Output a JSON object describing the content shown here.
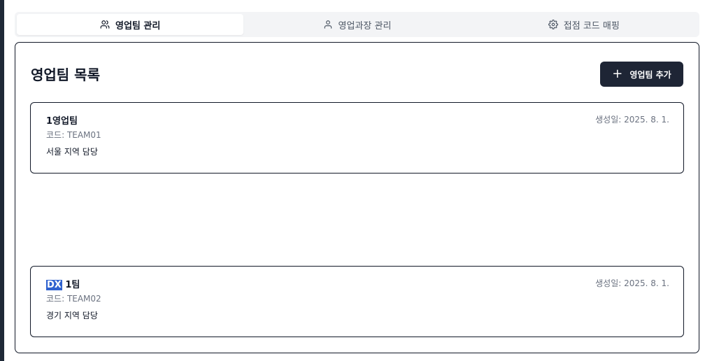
{
  "tabs": [
    {
      "label": "영업팀 관리",
      "icon": "users-icon",
      "active": true
    },
    {
      "label": "영업과장 관리",
      "icon": "user-icon",
      "active": false
    },
    {
      "label": "접점 코드 매핑",
      "icon": "gear-icon",
      "active": false
    }
  ],
  "list": {
    "title": "영업팀 목록",
    "add_button_label": "영업팀 추가",
    "add_button_icon": "plus-icon"
  },
  "teams": [
    {
      "name": "1영업팀",
      "code": "코드: TEAM01",
      "description": "서울 지역 담당",
      "created": "생성일: 2025. 8. 1."
    },
    {
      "name_highlight": "DX",
      "name_rest": " 1팀",
      "code": "코드: TEAM02",
      "description": "경기 지역 담당",
      "created": "생성일: 2025. 8. 1."
    }
  ],
  "colors": {
    "primary_button": "#1e2535",
    "selection_highlight": "#2f62cf",
    "muted_text": "#6b7280"
  }
}
